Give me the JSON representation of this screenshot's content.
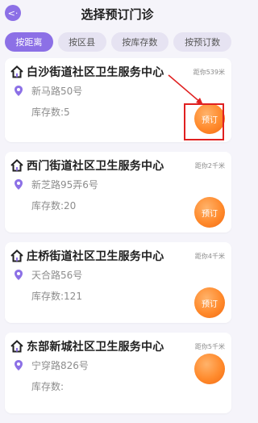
{
  "header": {
    "title": "选择预订门诊",
    "back_icon": "back-icon"
  },
  "tabs": [
    {
      "label": "按距离",
      "active": true
    },
    {
      "label": "按区县",
      "active": false
    },
    {
      "label": "按库存数",
      "active": false
    },
    {
      "label": "按预订数",
      "active": false
    }
  ],
  "clinics": [
    {
      "name": "白沙街道社区卫生服务中心",
      "distance": "距你539米",
      "address": "新马路50号",
      "stock": "库存数:5",
      "button": "预订"
    },
    {
      "name": "西门街道社区卫生服务中心",
      "distance": "距你2千米",
      "address": "新芝路95弄6号",
      "stock": "库存数:20",
      "button": "预订"
    },
    {
      "name": "庄桥街道社区卫生服务中心",
      "distance": "距你4千米",
      "address": "天合路56号",
      "stock": "库存数:121",
      "button": "预订"
    },
    {
      "name": "东部新城社区卫生服务中心",
      "distance": "距你5千米",
      "address": "宁穿路826号",
      "stock": "库存数:",
      "button": ""
    }
  ],
  "colors": {
    "accent": "#8c70e6",
    "button_orange": "#ff8a2c",
    "highlight": "#e02020"
  }
}
